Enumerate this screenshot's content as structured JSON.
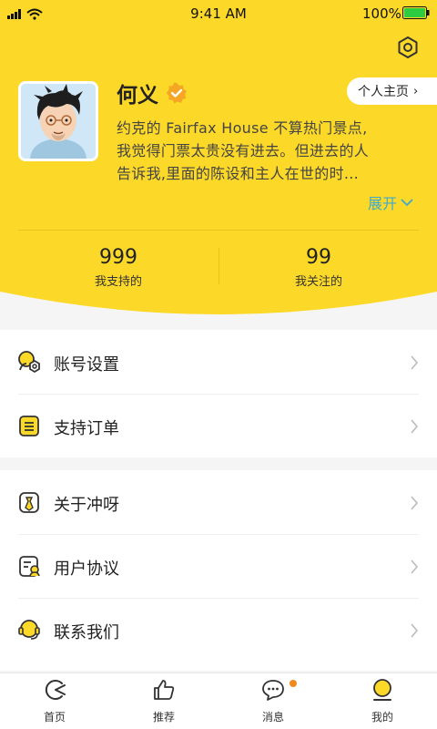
{
  "status_bar": {
    "time": "9:41 AM",
    "battery": "100%"
  },
  "profile": {
    "name": "何义",
    "homepage_button": "个人主页",
    "bio_lines": [
      "约克的 Fairfax House 不算热门景点,",
      "我觉得门票太贵没有进去。但进去的人",
      "告诉我,里面的陈设和主人在世的时..."
    ],
    "expand_label": "展开"
  },
  "stats": [
    {
      "value": "999",
      "label": "我支持的"
    },
    {
      "value": "99",
      "label": "我关注的"
    }
  ],
  "menu": {
    "group1": [
      {
        "label": "账号设置",
        "icon": "account-settings-icon"
      },
      {
        "label": "支持订单",
        "icon": "order-icon"
      }
    ],
    "group2": [
      {
        "label": "关于冲呀",
        "icon": "about-icon"
      },
      {
        "label": "用户协议",
        "icon": "agreement-icon"
      },
      {
        "label": "联系我们",
        "icon": "contact-icon"
      }
    ]
  },
  "tabbar": [
    {
      "label": "首页",
      "icon": "home-icon"
    },
    {
      "label": "推荐",
      "icon": "thumbs-up-icon"
    },
    {
      "label": "消息",
      "icon": "message-icon",
      "badge": true
    },
    {
      "label": "我的",
      "icon": "profile-icon",
      "active": true
    }
  ],
  "colors": {
    "brand_yellow": "#fcd928",
    "accent_blue": "#3fa8ce",
    "badge_orange": "#f08a1d",
    "verified_orange": "#f5a623"
  }
}
